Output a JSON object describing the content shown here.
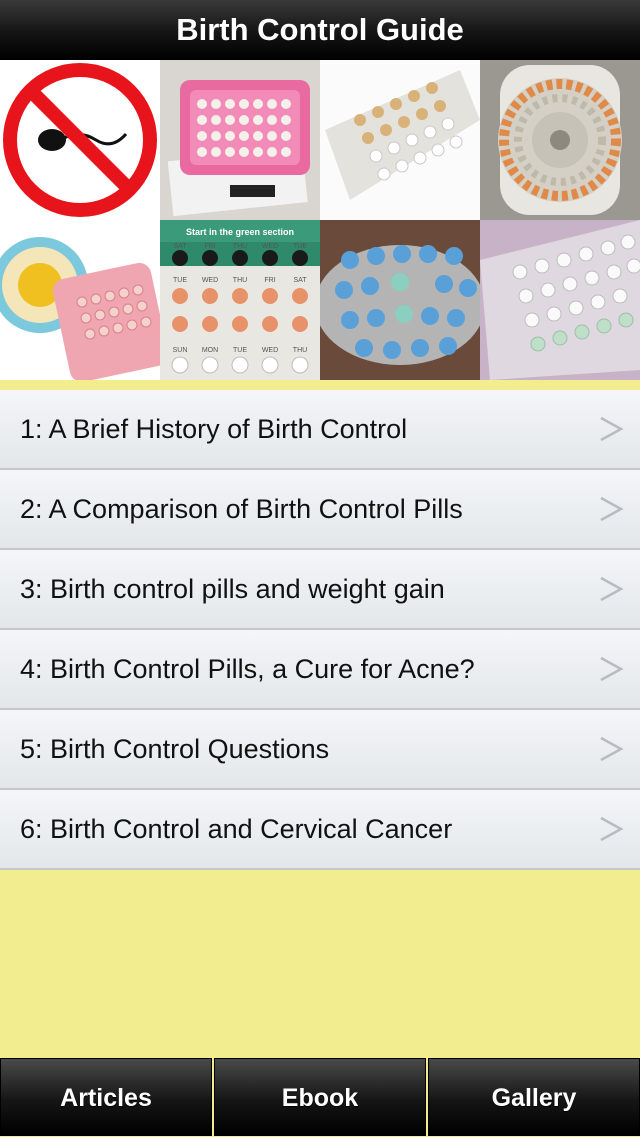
{
  "header": {
    "title": "Birth Control Guide"
  },
  "gallery": {
    "tiles": [
      {
        "icon": "no-sperm-sign-image"
      },
      {
        "icon": "pink-pill-case-image"
      },
      {
        "icon": "pill-blister-pack-image"
      },
      {
        "icon": "round-pill-dispenser-image"
      },
      {
        "icon": "pill-wheel-and-pack-image"
      },
      {
        "icon": "day-labeled-pill-pack-image",
        "text": "Start in the green section",
        "days": [
          "SAT",
          "FRI",
          "THU",
          "WED",
          "TUE",
          "TUE",
          "WED",
          "THU",
          "FRI",
          "SAT",
          "SUN",
          "MON",
          "TUE",
          "WED",
          "THU"
        ]
      },
      {
        "icon": "blue-pill-blister-image"
      },
      {
        "icon": "white-pill-blister-image"
      }
    ]
  },
  "articles": [
    {
      "label": "1: A Brief History of Birth Control"
    },
    {
      "label": "2: A Comparison of Birth Control Pills"
    },
    {
      "label": "3: Birth control pills and weight gain"
    },
    {
      "label": "4: Birth Control Pills, a Cure for Acne?"
    },
    {
      "label": "5: Birth Control Questions"
    },
    {
      "label": "6: Birth Control and Cervical Cancer"
    }
  ],
  "tabbar": {
    "tabs": [
      {
        "label": "Articles"
      },
      {
        "label": "Ebook"
      },
      {
        "label": "Gallery"
      }
    ]
  },
  "colors": {
    "background": "#f2ed8f",
    "row_bg": "#eaedf0",
    "chevron": "#b8bcc2",
    "bar": "#141414"
  }
}
